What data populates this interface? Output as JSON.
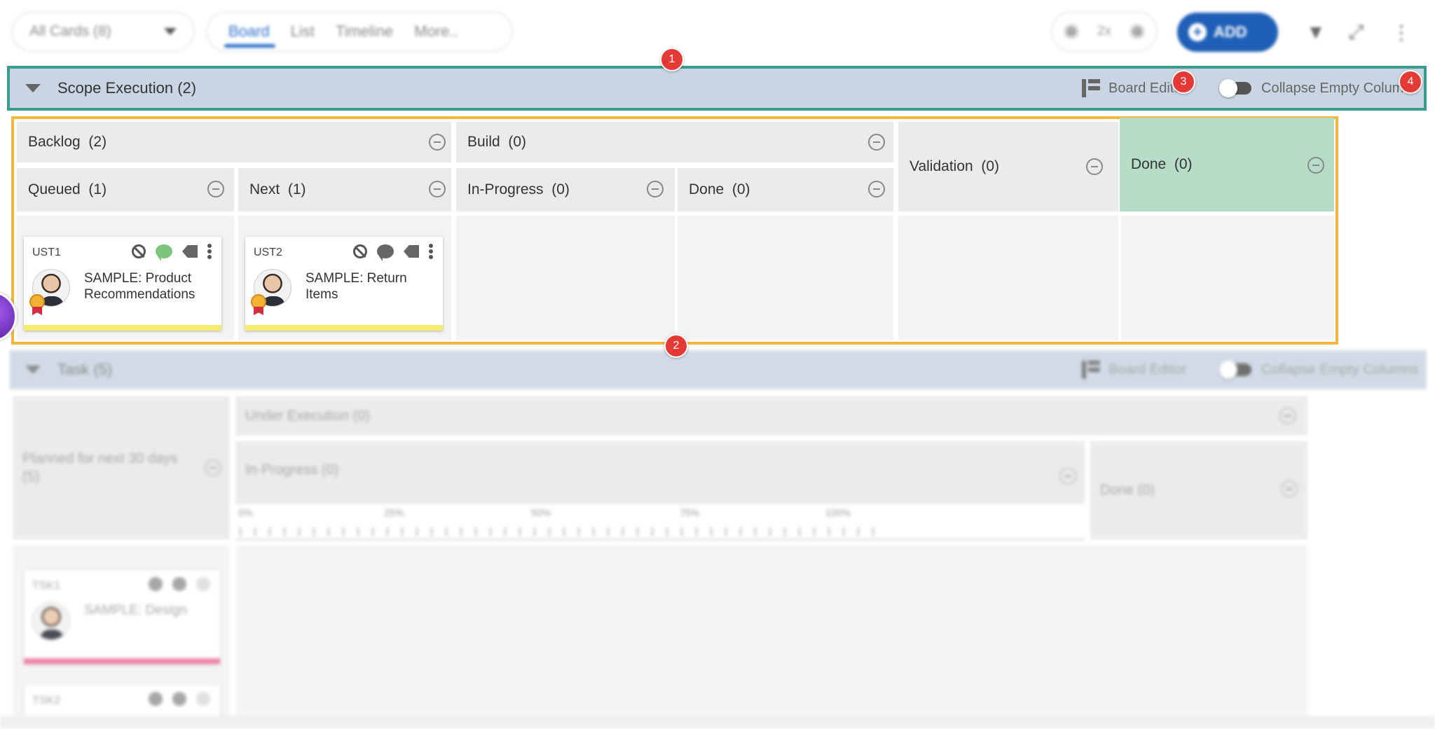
{
  "toolbar": {
    "cards_filter": "All Cards (8)",
    "tabs": [
      {
        "label": "Board",
        "active": true
      },
      {
        "label": "List",
        "active": false
      },
      {
        "label": "Timeline",
        "active": false
      },
      {
        "label": "More..",
        "active": false
      }
    ],
    "zoom_label": "2x",
    "add_label": "ADD",
    "icons": [
      "filter-icon",
      "fullscreen-icon",
      "more-vertical-icon"
    ]
  },
  "badges": [
    "1",
    "2",
    "3",
    "4"
  ],
  "scope_lane": {
    "title": "Scope Execution",
    "count": "(2)",
    "board_editor_label": "Board Editor",
    "collapse_label": "Collapse Empty Columns",
    "columns": {
      "backlog": {
        "name": "Backlog",
        "count": "(2)"
      },
      "build": {
        "name": "Build",
        "count": "(0)"
      },
      "queued": {
        "name": "Queued",
        "count": "(1)"
      },
      "next": {
        "name": "Next",
        "count": "(1)"
      },
      "in_progress": {
        "name": "In-Progress",
        "count": "(0)"
      },
      "build_done": {
        "name": "Done",
        "count": "(0)"
      },
      "validation": {
        "name": "Validation",
        "count": "(0)"
      },
      "done": {
        "name": "Done",
        "count": "(0)"
      }
    },
    "cards": [
      {
        "id": "UST1",
        "title": "SAMPLE: Product Recommendations",
        "chat_active": true
      },
      {
        "id": "UST2",
        "title": "SAMPLE: Return Items",
        "chat_active": false
      }
    ],
    "colors": {
      "border_lane": "#3a9c8f",
      "border_board": "#f0b93d",
      "done_column": "#b7dcc7",
      "card_stripe": "#f7ec6e"
    }
  },
  "task_lane": {
    "title": "Task",
    "count": "(5)",
    "board_editor_label": "Board Editor",
    "collapse_label": "Collapse Empty Columns",
    "planned": "Planned for next 30 days (5)",
    "under_execution": "Under Execution (0)",
    "in_progress": "In-Progress (0)",
    "done": "Done (0)",
    "progress_labels": [
      "0%",
      "25%",
      "50%",
      "75%",
      "100%"
    ],
    "cards": [
      {
        "id": "TSK1",
        "title": "SAMPLE: Design"
      },
      {
        "id": "TSK2",
        "title": ""
      }
    ]
  }
}
